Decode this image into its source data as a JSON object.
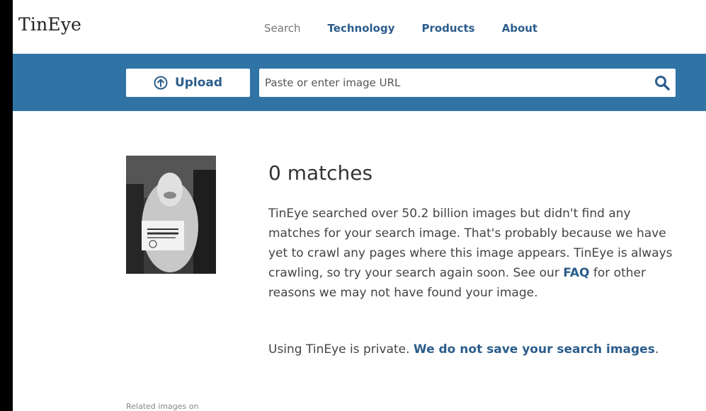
{
  "header": {
    "logo": "TinEye",
    "nav": [
      {
        "label": "Search"
      },
      {
        "label": "Technology"
      },
      {
        "label": "Products"
      },
      {
        "label": "About"
      }
    ]
  },
  "searchbar": {
    "upload_label": "Upload",
    "url_placeholder": "Paste or enter image URL"
  },
  "result": {
    "count_title": "0 matches",
    "desc_before_link": "TinEye searched over 50.2 billion images but didn't find any matches for your search image. That's probably because we have yet to crawl any pages where this image appears. TinEye is always crawling, so try your search again soon. See our ",
    "faq_link": "FAQ",
    "desc_after_link": " for other reasons we may not have found your image.",
    "privacy_text": "Using TinEye is private. ",
    "privacy_link": "We do not save your search images",
    "privacy_end": "."
  },
  "footer": {
    "related_label": "Related images on"
  },
  "colors": {
    "accent": "#3074a6",
    "link": "#2b5d8c"
  }
}
